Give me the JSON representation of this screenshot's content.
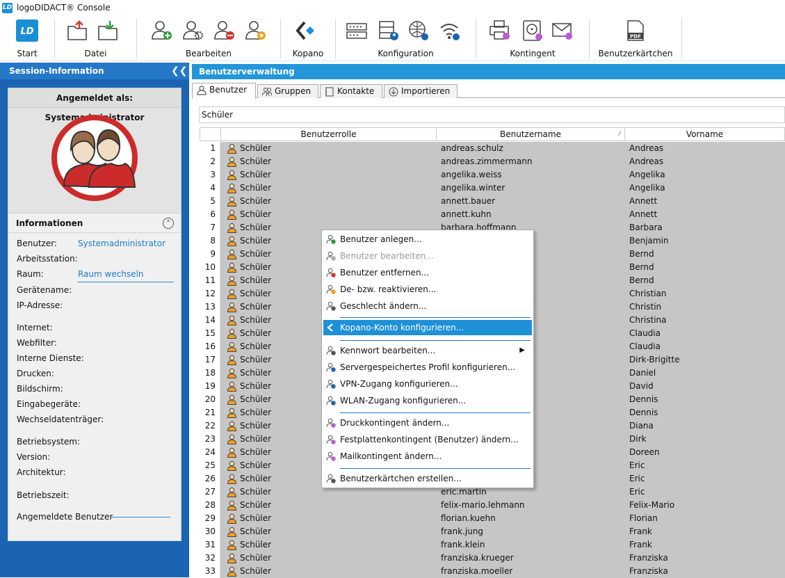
{
  "app": {
    "logo": "LD",
    "title": "logoDIDACT® Console"
  },
  "ribbon": {
    "groups": [
      {
        "label": "Start"
      },
      {
        "label": "Datei"
      },
      {
        "label": "Bearbeiten"
      },
      {
        "label": "Kopano"
      },
      {
        "label": "Konfiguration"
      },
      {
        "label": "Kontingent"
      },
      {
        "label": "Benutzerkärtchen"
      }
    ]
  },
  "session": {
    "header": "Session-Information",
    "logged_in_as": "Angemeldet als: Systemadministrator",
    "info_title": "Informationen",
    "fields": [
      {
        "label": "Benutzer:",
        "value": "Systemadministrator"
      },
      {
        "label": "Arbeitsstation:",
        "value": ""
      },
      {
        "label": "Raum:",
        "value": "Raum wechseln"
      },
      {
        "label": "Gerätename:",
        "value": ""
      },
      {
        "label": "IP-Adresse:",
        "value": ""
      },
      {
        "label": "Internet:",
        "value": ""
      },
      {
        "label": "Webfilter:",
        "value": ""
      },
      {
        "label": "Interne Dienste:",
        "value": ""
      },
      {
        "label": "Drucken:",
        "value": ""
      },
      {
        "label": "Bildschirm:",
        "value": ""
      },
      {
        "label": "Eingabegeräte:",
        "value": ""
      },
      {
        "label": "Wechseldatenträger:",
        "value": ""
      },
      {
        "label": "Betriebsystem:",
        "value": ""
      },
      {
        "label": "Version:",
        "value": ""
      },
      {
        "label": "Architektur:",
        "value": ""
      },
      {
        "label": "Betriebszeit:",
        "value": ""
      },
      {
        "label": "Angemeldete Benutzer",
        "value": ""
      }
    ]
  },
  "main": {
    "header": "Benutzerverwaltung",
    "tabs": [
      {
        "label": "Benutzer"
      },
      {
        "label": "Gruppen"
      },
      {
        "label": "Kontakte"
      },
      {
        "label": "Importieren"
      }
    ],
    "filter_value": "Schüler",
    "columns": [
      "Benutzerrolle",
      "Benutzername",
      "Vorname"
    ],
    "rows": [
      {
        "n": "1",
        "role": "Schüler",
        "user": "andreas.schulz",
        "first": "Andreas"
      },
      {
        "n": "2",
        "role": "Schüler",
        "user": "andreas.zimmermann",
        "first": "Andreas"
      },
      {
        "n": "3",
        "role": "Schüler",
        "user": "angelika.weiss",
        "first": "Angelika"
      },
      {
        "n": "4",
        "role": "Schüler",
        "user": "angelika.winter",
        "first": "Angelika"
      },
      {
        "n": "5",
        "role": "Schüler",
        "user": "annett.bauer",
        "first": "Annett"
      },
      {
        "n": "6",
        "role": "Schüler",
        "user": "annett.kuhn",
        "first": "Annett"
      },
      {
        "n": "7",
        "role": "Schüler",
        "user": "barbara.hoffmann",
        "first": "Barbara"
      },
      {
        "n": "8",
        "role": "Schüler",
        "user": "",
        "first": "Benjamin"
      },
      {
        "n": "9",
        "role": "Schüler",
        "user": "",
        "first": "Bernd"
      },
      {
        "n": "10",
        "role": "Schüler",
        "user": "",
        "first": "Bernd"
      },
      {
        "n": "11",
        "role": "Schüler",
        "user": "",
        "first": "Bernd"
      },
      {
        "n": "12",
        "role": "Schüler",
        "user": "",
        "first": "Christian"
      },
      {
        "n": "13",
        "role": "Schüler",
        "user": "",
        "first": "Christin"
      },
      {
        "n": "14",
        "role": "Schüler",
        "user": "",
        "first": "Christina"
      },
      {
        "n": "15",
        "role": "Schüler",
        "user": "",
        "first": "Claudia"
      },
      {
        "n": "16",
        "role": "Schüler",
        "user": "",
        "first": "Claudia"
      },
      {
        "n": "17",
        "role": "Schüler",
        "user": "",
        "first": "Dirk-Brigitte"
      },
      {
        "n": "18",
        "role": "Schüler",
        "user": "",
        "first": "Daniel"
      },
      {
        "n": "19",
        "role": "Schüler",
        "user": "",
        "first": "David"
      },
      {
        "n": "20",
        "role": "Schüler",
        "user": "",
        "first": "Dennis"
      },
      {
        "n": "21",
        "role": "Schüler",
        "user": "",
        "first": "Dennis"
      },
      {
        "n": "22",
        "role": "Schüler",
        "user": "",
        "first": "Diana"
      },
      {
        "n": "23",
        "role": "Schüler",
        "user": "",
        "first": "Dirk"
      },
      {
        "n": "24",
        "role": "Schüler",
        "user": "",
        "first": "Doreen"
      },
      {
        "n": "25",
        "role": "Schüler",
        "user": "",
        "first": "Eric"
      },
      {
        "n": "26",
        "role": "Schüler",
        "user": "",
        "first": "Eric"
      },
      {
        "n": "27",
        "role": "Schüler",
        "user": "eric.martin",
        "first": "Eric"
      },
      {
        "n": "28",
        "role": "Schüler",
        "user": "felix-mario.lehmann",
        "first": "Felix-Mario"
      },
      {
        "n": "29",
        "role": "Schüler",
        "user": "florian.kuehn",
        "first": "Florian"
      },
      {
        "n": "30",
        "role": "Schüler",
        "user": "frank.jung",
        "first": "Frank"
      },
      {
        "n": "31",
        "role": "Schüler",
        "user": "frank.klein",
        "first": "Frank"
      },
      {
        "n": "32",
        "role": "Schüler",
        "user": "franziska.krueger",
        "first": "Franziska"
      },
      {
        "n": "33",
        "role": "Schüler",
        "user": "franziska.moeller",
        "first": "Franziska"
      }
    ]
  },
  "context_menu": {
    "items": [
      {
        "label": "Benutzer anlegen...",
        "icon": "user-add-icon",
        "state": "normal"
      },
      {
        "label": "Benutzer bearbeiten...",
        "icon": "user-edit-icon",
        "state": "disabled"
      },
      {
        "label": "Benutzer entfernen...",
        "icon": "user-remove-icon",
        "state": "normal"
      },
      {
        "label": "De- bzw. reaktivieren...",
        "icon": "user-toggle-icon",
        "state": "normal"
      },
      {
        "label": "Geschlecht ändern...",
        "icon": "gender-icon",
        "state": "normal"
      },
      {
        "label": "Kopano-Konto konfigurieren...",
        "icon": "kopano-icon",
        "state": "highlighted"
      },
      {
        "label": "Kennwort bearbeiten...",
        "icon": "password-icon",
        "state": "submenu"
      },
      {
        "label": "Servergespeichertes Profil konfigurieren...",
        "icon": "server-profile-icon",
        "state": "normal"
      },
      {
        "label": "VPN-Zugang konfigurieren...",
        "icon": "vpn-icon",
        "state": "normal"
      },
      {
        "label": "WLAN-Zugang konfigurieren...",
        "icon": "wlan-icon",
        "state": "normal"
      },
      {
        "label": "Druckkontingent ändern...",
        "icon": "print-quota-icon",
        "state": "normal"
      },
      {
        "label": "Festplattenkontingent (Benutzer) ändern...",
        "icon": "disk-quota-icon",
        "state": "normal"
      },
      {
        "label": "Mailkontingent ändern...",
        "icon": "mail-quota-icon",
        "state": "normal"
      },
      {
        "label": "Benutzerkärtchen erstellen...",
        "icon": "user-card-icon",
        "state": "normal"
      }
    ]
  },
  "colors": {
    "accent_blue": "#1e90d8",
    "left_panel_blue": "#1b64b3",
    "selected_row": "#c6c6c6",
    "avatar_red": "#cc2b2b",
    "badge_purple": "#b85cd6"
  }
}
